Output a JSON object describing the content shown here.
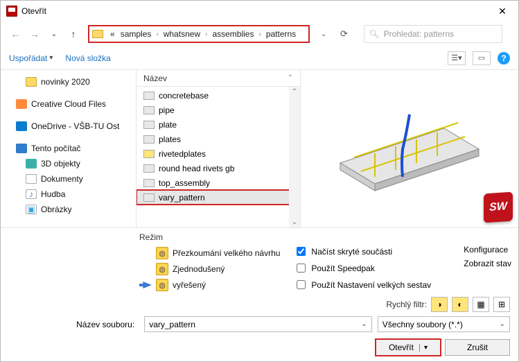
{
  "titlebar": {
    "title": "Otevřít"
  },
  "breadcrumb": {
    "prefix": "«",
    "items": [
      "samples",
      "whatsnew",
      "assemblies",
      "patterns"
    ]
  },
  "search": {
    "placeholder": "Prohledat: patterns"
  },
  "toolbar": {
    "organize": "Uspořádat",
    "newfolder": "Nová složka"
  },
  "sidebar": {
    "items": [
      {
        "label": "novinky 2020",
        "icon": "folder",
        "level": 2
      },
      {
        "label": "Creative Cloud Files",
        "icon": "cloud",
        "level": 1,
        "gap": true
      },
      {
        "label": "OneDrive - VŠB-TU Ost",
        "icon": "onedrive",
        "level": 1,
        "gap": true
      },
      {
        "label": "Tento počítač",
        "icon": "pc",
        "level": 1,
        "gap": true
      },
      {
        "label": "3D objekty",
        "icon": "3d",
        "level": 2
      },
      {
        "label": "Dokumenty",
        "icon": "doc",
        "level": 2
      },
      {
        "label": "Hudba",
        "icon": "music",
        "level": 2
      },
      {
        "label": "Obrázky",
        "icon": "pic",
        "level": 2
      }
    ]
  },
  "filepane": {
    "header": "Název",
    "items": [
      {
        "label": "concretebase"
      },
      {
        "label": "pipe"
      },
      {
        "label": "plate"
      },
      {
        "label": "plates"
      },
      {
        "label": "rivetedplates"
      },
      {
        "label": "round head rivets gb"
      },
      {
        "label": "top_assembly"
      },
      {
        "label": "vary_pattern",
        "selected": true
      }
    ]
  },
  "mode": {
    "label": "Režim",
    "options": [
      "Přezkoumání velkého návrhu",
      "Zjednodušený",
      "vyřešený"
    ]
  },
  "checks": {
    "hidden": {
      "label": "Načíst skryté součásti",
      "checked": true
    },
    "speedpak": {
      "label": "Použít Speedpak",
      "checked": false
    },
    "largeasm": {
      "label": "Použít Nastavení velkých sestav",
      "checked": false
    }
  },
  "rightlabels": {
    "config": "Konfigurace",
    "dispstate": "Zobrazit stav"
  },
  "quickfilter": {
    "label": "Rychlý filtr:"
  },
  "filename": {
    "label": "Název souboru:",
    "value": "vary_pattern"
  },
  "typeselect": {
    "value": "Všechny soubory (*.*)"
  },
  "buttons": {
    "open": "Otevřít",
    "cancel": "Zrušit"
  },
  "swbadge": "SW"
}
